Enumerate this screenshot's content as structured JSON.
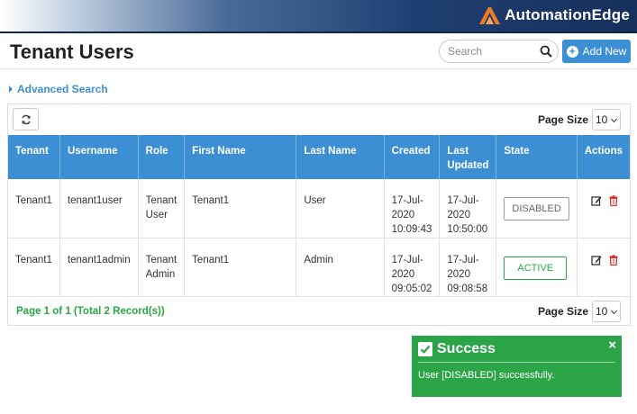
{
  "brand": {
    "name": "AutomationEdge",
    "accent": "#f07c22"
  },
  "page": {
    "title": "Tenant Users"
  },
  "search": {
    "placeholder": "Search"
  },
  "toolbar": {
    "add_label": "Add New",
    "page_size_label": "Page Size",
    "page_size_value": "10"
  },
  "advanced_search": {
    "label": "Advanced Search"
  },
  "table": {
    "headers": [
      "Tenant",
      "Username",
      "Role",
      "First Name",
      "Last Name",
      "Created",
      "Last Updated",
      "State",
      "Actions"
    ],
    "rows": [
      {
        "tenant": "Tenant1",
        "username": "tenant1user",
        "role": "Tenant User",
        "first_name": "Tenant1",
        "last_name": "User",
        "created": "17-Jul-2020 10:09:43",
        "last_updated": "17-Jul-2020 10:50:00",
        "state": "DISABLED"
      },
      {
        "tenant": "Tenant1",
        "username": "tenant1admin",
        "role": "Tenant Admin",
        "first_name": "Tenant1",
        "last_name": "Admin",
        "created": "17-Jul-2020 09:05:02",
        "last_updated": "17-Jul-2020 09:08:58",
        "state": "ACTIVE"
      }
    ]
  },
  "footer": {
    "info": "Page 1 of 1 (Total 2 Record(s))",
    "page_size_label": "Page Size",
    "page_size_value": "10"
  },
  "toast": {
    "title": "Success",
    "message": "User [DISABLED] successfully.",
    "close": "×"
  },
  "colors": {
    "primary": "#3d8fd4",
    "success": "#2ca548",
    "danger": "#d9302c"
  },
  "icons": {
    "search": "search-icon",
    "add": "plus-circle-icon",
    "refresh": "refresh-icon",
    "edit": "edit-icon",
    "delete": "trash-icon",
    "check": "check-square-icon",
    "close": "close-icon"
  }
}
